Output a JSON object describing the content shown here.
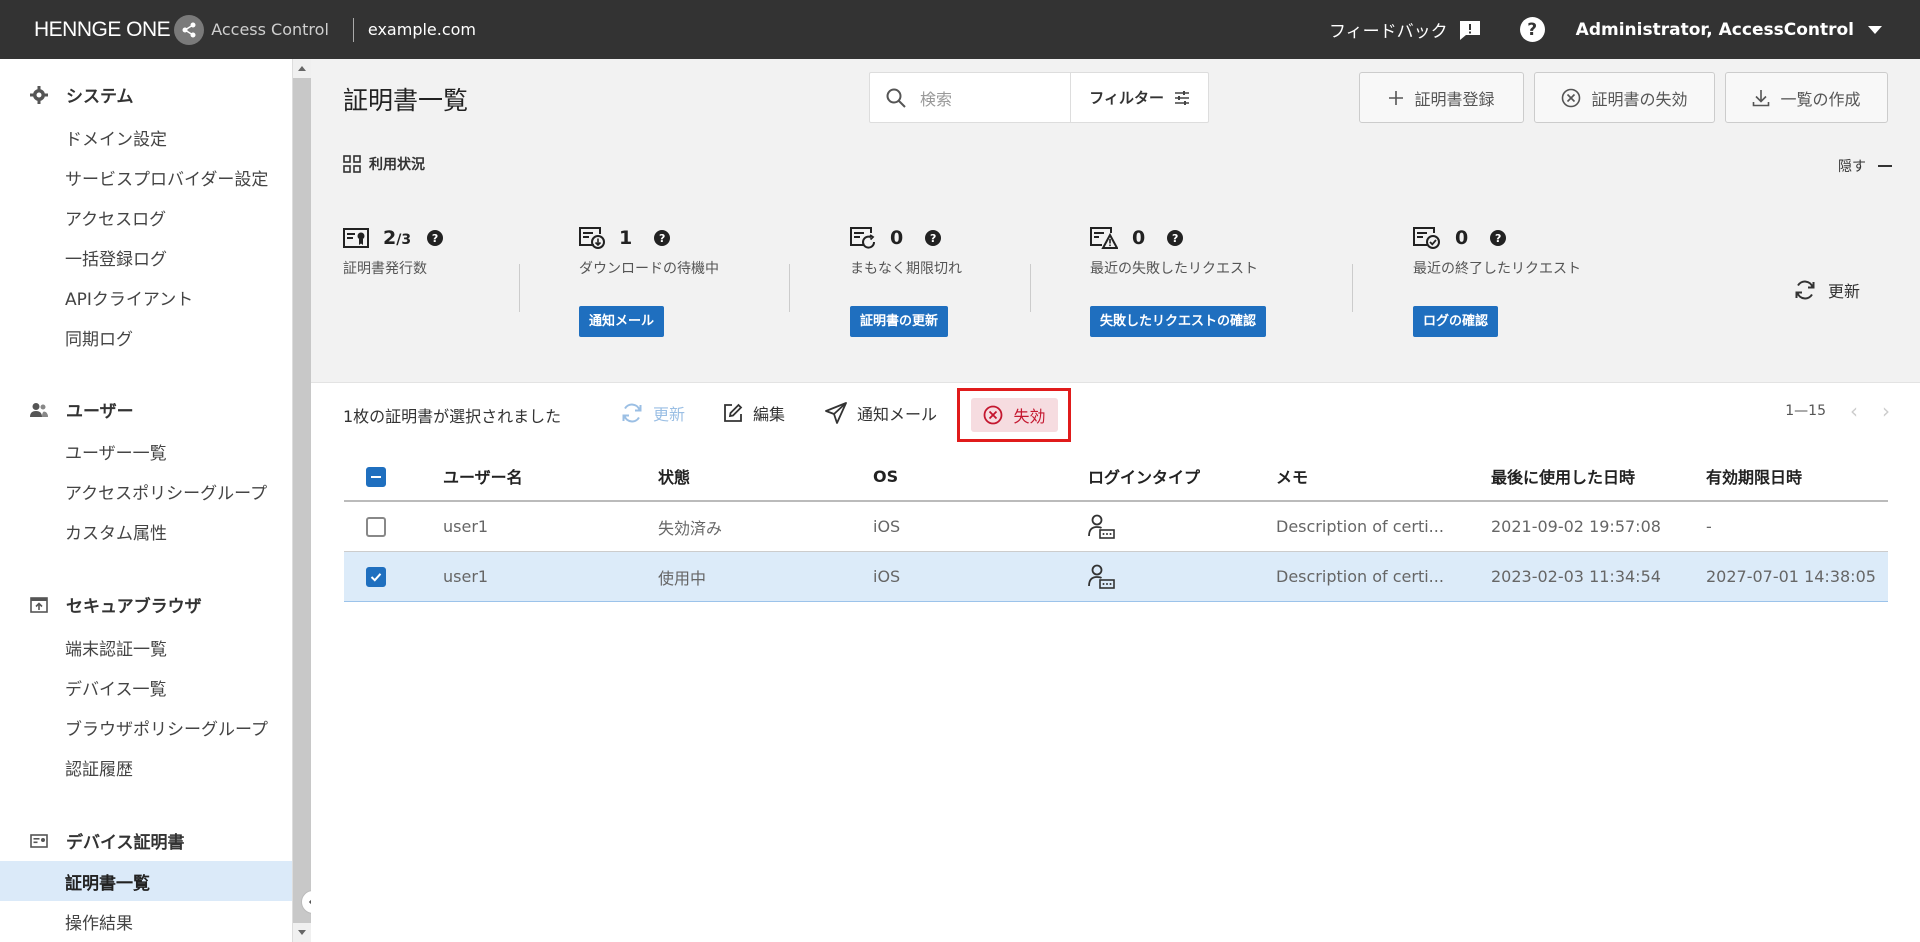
{
  "header": {
    "brand": "HENNGE ONE",
    "product": "Access Control",
    "domain": "example.com",
    "feedback": "フィードバック",
    "help": "?",
    "user": "Administrator, AccessControl"
  },
  "sidebar": {
    "sections": [
      {
        "title": "システム",
        "icon": "gear-icon",
        "items": [
          "ドメイン設定",
          "サービスプロバイダー設定",
          "アクセスログ",
          "一括登録ログ",
          "APIクライアント",
          "同期ログ"
        ]
      },
      {
        "title": "ユーザー",
        "icon": "users-icon",
        "items": [
          "ユーザー一覧",
          "アクセスポリシーグループ",
          "カスタム属性"
        ]
      },
      {
        "title": "セキュアブラウザ",
        "icon": "secure-browser-icon",
        "items": [
          "端末認証一覧",
          "デバイス一覧",
          "ブラウザポリシーグループ",
          "認証履歴"
        ]
      },
      {
        "title": "デバイス証明書",
        "icon": "certificate-icon",
        "items": [
          "証明書一覧",
          "操作結果"
        ]
      }
    ],
    "active_item": "証明書一覧"
  },
  "page": {
    "title": "証明書一覧",
    "search_placeholder": "検索",
    "filter_label": "フィルター",
    "register_label": "証明書登録",
    "revoke_header_label": "証明書の失効",
    "export_label": "一覧の作成"
  },
  "usage": {
    "label": "利用状況",
    "hide_label": "隠す",
    "refresh_label": "更新",
    "stats": [
      {
        "value": "2",
        "sub": "/3",
        "label": "証明書発行数",
        "action": ""
      },
      {
        "value": "1",
        "sub": "",
        "label": "ダウンロードの待機中",
        "action": "通知メール"
      },
      {
        "value": "0",
        "sub": "",
        "label": "まもなく期限切れ",
        "action": "証明書の更新"
      },
      {
        "value": "0",
        "sub": "",
        "label": "最近の失敗したリクエスト",
        "action": "失敗したリクエストの確認"
      },
      {
        "value": "0",
        "sub": "",
        "label": "最近の終了したリクエスト",
        "action": "ログの確認"
      }
    ]
  },
  "toolbar": {
    "selection_text": "1枚の証明書が選択されました",
    "refresh": "更新",
    "edit": "編集",
    "notify": "通知メール",
    "revoke": "失効",
    "pagination": "1—15"
  },
  "table": {
    "columns": [
      "ユーザー名",
      "状態",
      "OS",
      "ログインタイプ",
      "メモ",
      "最後に使用した日時",
      "有効期限日時"
    ],
    "rows": [
      {
        "user": "user1",
        "status": "失効済み",
        "os": "iOS",
        "login_type_icon": "user-password-icon",
        "memo": "Description of certi...",
        "last_used": "2021-09-02 19:57:08",
        "expires": "-",
        "selected": false
      },
      {
        "user": "user1",
        "status": "使用中",
        "os": "iOS",
        "login_type_icon": "user-password-icon",
        "memo": "Description of certi...",
        "last_used": "2023-02-03 11:34:54",
        "expires": "2027-07-01 14:38:05",
        "selected": true
      }
    ]
  },
  "colors": {
    "header_bg": "#333333",
    "accent": "#1f6fbf",
    "active_nav_bg": "#dbeaf9",
    "revoke_text": "#c4172f",
    "highlight_border": "#e01b1b"
  }
}
